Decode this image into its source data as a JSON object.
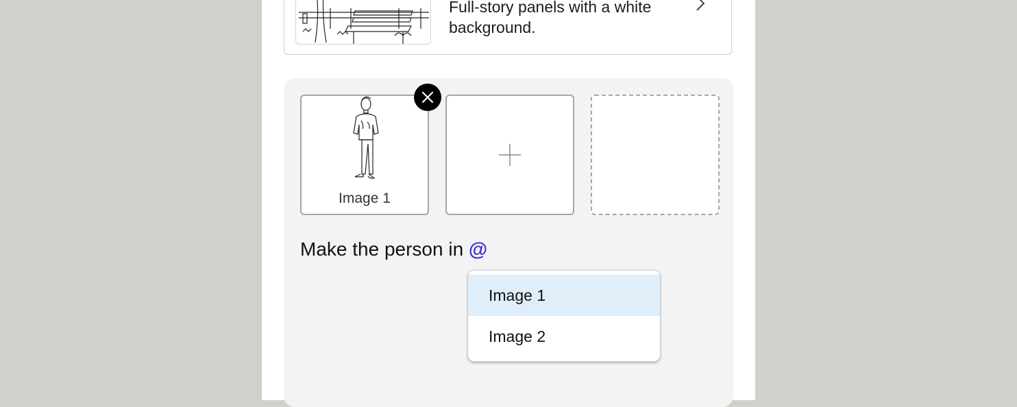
{
  "style_card": {
    "description": "Full-story panels with a white background.",
    "chevron_icon": "chevron-right-icon"
  },
  "reference_images": {
    "slots": [
      {
        "label": "Image 1",
        "state": "filled"
      },
      {
        "state": "add"
      },
      {
        "state": "empty"
      }
    ],
    "remove_icon": "close-icon",
    "add_icon": "plus-icon"
  },
  "prompt": {
    "text": "Make the person in ",
    "mention_trigger": "@"
  },
  "mention_dropdown": {
    "options": [
      {
        "label": "Image 1",
        "highlighted": true
      },
      {
        "label": "Image 2",
        "highlighted": false
      }
    ]
  },
  "colors": {
    "accent": "#3b2ed6",
    "highlight": "#e0eefa"
  }
}
